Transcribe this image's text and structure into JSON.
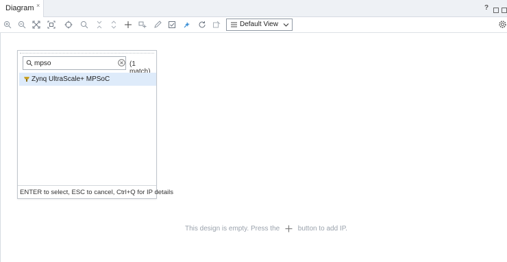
{
  "tabs": [
    {
      "label": "Diagram",
      "close_glyph": "×"
    }
  ],
  "window_controls": {
    "help_label": "?",
    "restore_icon": "restore-icon",
    "maximize_icon": "maximize-icon"
  },
  "toolbar": {
    "buttons": [
      "zoom-in-icon",
      "zoom-out-icon",
      "zoom-fit-icon",
      "fit-selection-icon",
      "auto-connect-icon",
      "search-icon",
      "collapse-icon",
      "expand-icon",
      "add-ip-icon",
      "add-module-icon",
      "validate-pencil-icon",
      "validate-check-icon",
      "run-automation-icon",
      "regenerate-layout-icon",
      "optimize-routing-icon"
    ],
    "view_select": {
      "value": "Default View"
    },
    "settings_icon": "gear-icon"
  },
  "ip_search": {
    "query": "mpso",
    "match_count": "(1 match)",
    "results": [
      {
        "label": "Zynq UltraScale+ MPSoC",
        "icon": "ip-core-icon"
      }
    ],
    "footer": "ENTER to select, ESC to cancel, Ctrl+Q for IP details"
  },
  "canvas": {
    "empty_before": "This design is empty. Press the",
    "empty_after": "button to add IP."
  },
  "colors": {
    "accent": "#3a8fd6",
    "selection": "#deebfa",
    "hint_text": "#9aa2ac",
    "ip_icon": "#c9a227"
  }
}
